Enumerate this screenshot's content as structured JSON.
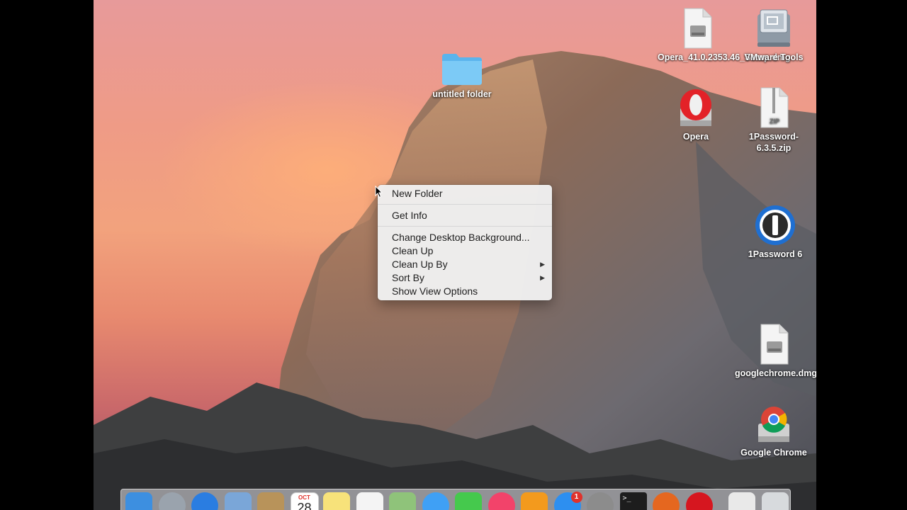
{
  "desktop": {
    "icons": [
      {
        "label": "untitled folder",
        "icon": "folder-icon"
      },
      {
        "label": "Opera_41.0.2353.46_Setup.dmg",
        "icon": "disk-image-icon"
      },
      {
        "label": "VMware Tools",
        "icon": "vmware-tools-icon"
      },
      {
        "label": "Opera",
        "icon": "opera-installer-icon"
      },
      {
        "label": "1Password-6.3.5.zip",
        "icon": "zip-file-icon"
      },
      {
        "label": "1Password 6",
        "icon": "1password-icon"
      },
      {
        "label": "googlechrome.dmg",
        "icon": "disk-image-icon"
      },
      {
        "label": "Google Chrome",
        "icon": "chrome-icon"
      }
    ],
    "zip_tag": "ZIP"
  },
  "context_menu": {
    "items": [
      {
        "label": "New Folder"
      },
      {
        "label": "Get Info"
      },
      {
        "label": "Change Desktop Background..."
      },
      {
        "label": "Clean Up"
      },
      {
        "label": "Clean Up By",
        "submenu": true
      },
      {
        "label": "Sort By",
        "submenu": true
      },
      {
        "label": "Show View Options"
      }
    ],
    "submenu_arrow": "▶"
  },
  "dock": {
    "items": [
      {
        "name": "finder-icon",
        "color": "#3d8fe0"
      },
      {
        "name": "launchpad-icon",
        "color": "#9aa3ad"
      },
      {
        "name": "safari-icon",
        "color": "#2a7de1"
      },
      {
        "name": "mail-icon",
        "color": "#7aa6d8"
      },
      {
        "name": "contacts-icon",
        "color": "#b8935a"
      },
      {
        "name": "calendar-icon",
        "color": "#ffffff"
      },
      {
        "name": "notes-icon",
        "color": "#f7e27a"
      },
      {
        "name": "reminders-icon",
        "color": "#f4f4f4"
      },
      {
        "name": "maps-icon",
        "color": "#8fc37a"
      },
      {
        "name": "messages-icon",
        "color": "#3fa0f5"
      },
      {
        "name": "facetime-icon",
        "color": "#45c94d"
      },
      {
        "name": "itunes-icon",
        "color": "#f2436a"
      },
      {
        "name": "ibooks-icon",
        "color": "#f39a1d"
      },
      {
        "name": "app-store-icon",
        "color": "#2d8ff0"
      },
      {
        "name": "system-preferences-icon",
        "color": "#8c8c8c"
      },
      {
        "name": "terminal-icon",
        "color": "#1d1d1d"
      },
      {
        "name": "firefox-icon",
        "color": "#e5671f"
      },
      {
        "name": "opera-icon",
        "color": "#d6161f"
      },
      {
        "name": "downloads-stack-icon",
        "color": "#e9e9e9"
      },
      {
        "name": "trash-icon",
        "color": "#d7dadd"
      }
    ],
    "calendar_month": "OCT",
    "calendar_day": "28",
    "app_store_badge": "1",
    "terminal_prompt": ">_"
  }
}
